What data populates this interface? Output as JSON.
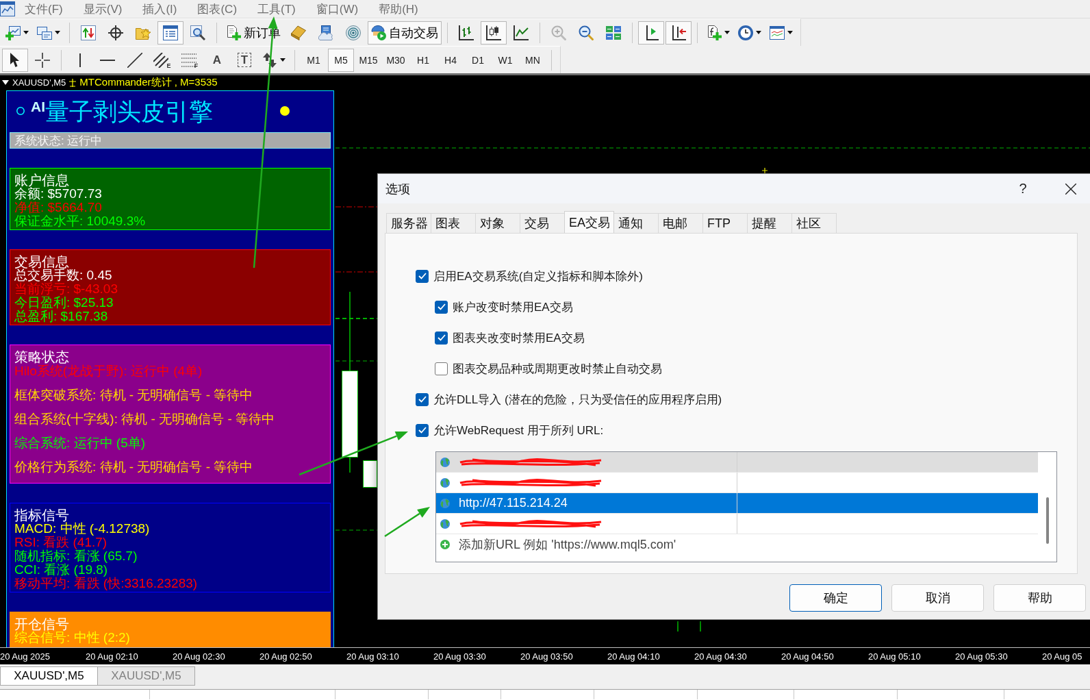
{
  "menu": [
    "文件(F)",
    "显示(V)",
    "插入(I)",
    "图表(C)",
    "工具(T)",
    "窗口(W)",
    "帮助(H)"
  ],
  "toolbar": [
    [
      {
        "kind": "icon",
        "selected": false,
        "dropdown": true
      },
      {
        "kind": "icon",
        "selected": false,
        "dropdown": true
      }
    ],
    [
      {
        "kind": "icon",
        "selected": false
      },
      {
        "kind": "icon",
        "selected": false
      },
      {
        "kind": "icon",
        "selected": false
      },
      {
        "kind": "icon",
        "selected": true
      },
      {
        "kind": "icon",
        "selected": false
      }
    ],
    [
      {
        "kind": "labeled",
        "label": "新订单",
        "selected": false
      },
      {
        "kind": "icon",
        "selected": false
      },
      {
        "kind": "icon",
        "selected": false
      },
      {
        "kind": "icon",
        "selected": false
      },
      {
        "kind": "labeled",
        "label": "自动交易",
        "selected": true
      }
    ],
    [
      {
        "kind": "icon",
        "selected": false
      },
      {
        "kind": "icon",
        "selected": true
      },
      {
        "kind": "icon",
        "selected": false
      }
    ],
    [
      {
        "kind": "icon",
        "selected": false,
        "disabled": true
      },
      {
        "kind": "icon",
        "selected": false,
        "disabled": false
      },
      {
        "kind": "icon",
        "selected": false,
        "disabled": false
      }
    ],
    [
      {
        "kind": "icon",
        "selected": true
      },
      {
        "kind": "icon",
        "selected": true
      }
    ],
    [
      {
        "kind": "icon",
        "selected": false,
        "dropdown": true
      },
      {
        "kind": "icon",
        "selected": false,
        "dropdown": true
      },
      {
        "kind": "icon",
        "selected": false,
        "dropdown": true
      }
    ]
  ],
  "drawing_toolbar": [
    [
      {
        "kind": "icon",
        "selected": true
      },
      {
        "kind": "icon",
        "selected": false
      }
    ],
    [
      {
        "kind": "icon",
        "selected": false
      },
      {
        "kind": "icon",
        "selected": false
      },
      {
        "kind": "icon",
        "selected": false
      },
      {
        "kind": "icon",
        "tag": "E",
        "selected": false
      },
      {
        "kind": "icon",
        "tag": "F",
        "selected": false
      },
      {
        "kind": "glyph",
        "label": "A",
        "selected": false
      },
      {
        "kind": "boxed_glyph",
        "label": "T",
        "selected": false
      },
      {
        "kind": "icon",
        "selected": false,
        "dropdown": true
      }
    ]
  ],
  "timeframes": [
    {
      "label": "M1",
      "selected": false
    },
    {
      "label": "M5",
      "selected": true
    },
    {
      "label": "M15",
      "selected": false
    },
    {
      "label": "M30",
      "selected": false
    },
    {
      "label": "H1",
      "selected": false
    },
    {
      "label": "H4",
      "selected": false
    },
    {
      "label": "D1",
      "selected": false
    },
    {
      "label": "W1",
      "selected": false
    },
    {
      "label": "MN",
      "selected": false
    }
  ],
  "chart": {
    "symbol": "XAUUSD',M5",
    "caption": "MTCommander统计 , M=3535",
    "time_labels": [
      "20 Aug 2025",
      "20 Aug 02:10",
      "20 Aug 02:30",
      "20 Aug 02:50",
      "20 Aug 03:10",
      "20 Aug 03:30",
      "20 Aug 03:50",
      "20 Aug 04:10",
      "20 Aug 04:30",
      "20 Aug 04:50",
      "20 Aug 05:10",
      "20 Aug 05:30",
      "20 Aug 05"
    ],
    "tabs": [
      {
        "label": "XAUUSD',M5",
        "selected": true
      },
      {
        "label": "XAUUSD',M5",
        "selected": false
      }
    ]
  },
  "panel": {
    "title": "$^{AI}$量子剥头皮引擎",
    "status_dot": {
      "color": "#ffff00"
    },
    "status": "系统状态: 运行中",
    "sections": [
      {
        "title": "账户信息",
        "color": "#006400",
        "frame": {
          "color": "#00ff00"
        },
        "kind": "compact",
        "lines": [
          {
            "text": "余额: $5707.73",
            "color": "#ffffff"
          },
          {
            "text": "净值: $5664.70",
            "color": "#ff0000"
          },
          {
            "text": "保证金水平: 10049.3%",
            "color": "#00ff00"
          }
        ]
      },
      {
        "title": "交易信息",
        "color": "#8b0000",
        "frame": {
          "color": "#ff0000"
        },
        "kind": "compact",
        "lines": [
          {
            "text": "总交易手数: 0.45",
            "color": "#ffffff"
          },
          {
            "text": "当前浮亏: $-43.03",
            "color": "#ff0000"
          },
          {
            "text": "今日盈利: $25.13",
            "color": "#00ff00"
          },
          {
            "text": "总盈利: $167.38",
            "color": "#00ff00"
          }
        ]
      },
      {
        "title": "策略状态",
        "color": "#8b008b",
        "frame": {
          "color": "#ff00ff"
        },
        "kind": "spaced",
        "lines": [
          {
            "text": "Hilo系统(龙战于野): 运行中 (4单)",
            "color": "#ff0000"
          },
          {
            "text": "框体突破系统: 待机 - 无明确信号 - 等待中",
            "color": "#ffd700"
          },
          {
            "text": "组合系统(十字线): 待机 - 无明确信号 - 等待中",
            "color": "#ffd700"
          },
          {
            "text": "综合系统: 运行中 (5单)",
            "color": "#00ff00"
          },
          {
            "text": "价格行为系统: 待机 - 无明确信号 - 等待中",
            "color": "#ffd700"
          }
        ]
      },
      {
        "title": "指标信号",
        "color": "#000088",
        "frame": {
          "color": "#0000ff"
        },
        "kind": "compact",
        "lines": [
          {
            "text": "MACD: 中性 (-4.12738)",
            "color": "#ffff00"
          },
          {
            "text": "RSI: 看跌 (41.7)",
            "color": "#ff0000"
          },
          {
            "text": "随机指标: 看涨 (65.7)",
            "color": "#00ff00"
          },
          {
            "text": "CCI: 看涨 (19.8)",
            "color": "#00ff00"
          },
          {
            "text": "移动平均: 看跌 (快:3316.23283)",
            "color": "#ff0000"
          }
        ]
      },
      {
        "title": "开仓信号",
        "color": "#ff8c00",
        "frame": {
          "color": "#ff8c00"
        },
        "kind": "compact",
        "lines": [
          {
            "text": "综合信号: 中性 (2:2)",
            "color": "#ffff00"
          }
        ]
      }
    ]
  },
  "dialog": {
    "title": "选项",
    "help": "?",
    "tabs": [
      {
        "label": "服务器",
        "selected": false
      },
      {
        "label": "图表",
        "selected": false
      },
      {
        "label": "对象",
        "selected": false
      },
      {
        "label": "交易",
        "selected": false
      },
      {
        "label": "EA交易",
        "selected": true
      },
      {
        "label": "通知",
        "selected": false
      },
      {
        "label": "电邮",
        "selected": false
      },
      {
        "label": "FTP",
        "selected": false
      },
      {
        "label": "提醒",
        "selected": false
      },
      {
        "label": "社区",
        "selected": false
      }
    ],
    "options": [
      {
        "label": "启用EA交易系统(自定义指标和脚本除外)",
        "checked": true,
        "children": [
          {
            "label": "账户改变时禁用EA交易",
            "checked": true
          },
          {
            "label": "图表夹改变时禁用EA交易",
            "checked": true
          },
          {
            "label": "图表交易品种或周期更改时禁止自动交易",
            "checked": false
          }
        ]
      },
      {
        "label": "允许DLL导入 (潜在的危险，只为受信任的应用程序启用)",
        "checked": true
      },
      {
        "label": "允许WebRequest 用于所列 URL:",
        "checked": true
      }
    ],
    "url_list": {
      "rows": [
        {
          "redacted": true,
          "selected": false,
          "hovered": true
        },
        {
          "redacted": true,
          "selected": false,
          "hovered": false
        },
        {
          "url": "http://47.115.214.24",
          "selected": true,
          "hovered": false
        },
        {
          "redacted": true,
          "selected": false,
          "hovered": false
        }
      ],
      "add_hint": "添加新URL 例如 'https://www.mql5.com'"
    },
    "buttons": [
      {
        "label": "确定",
        "default": true
      },
      {
        "label": "取消",
        "default": false
      },
      {
        "label": "帮助",
        "default": false
      }
    ]
  }
}
